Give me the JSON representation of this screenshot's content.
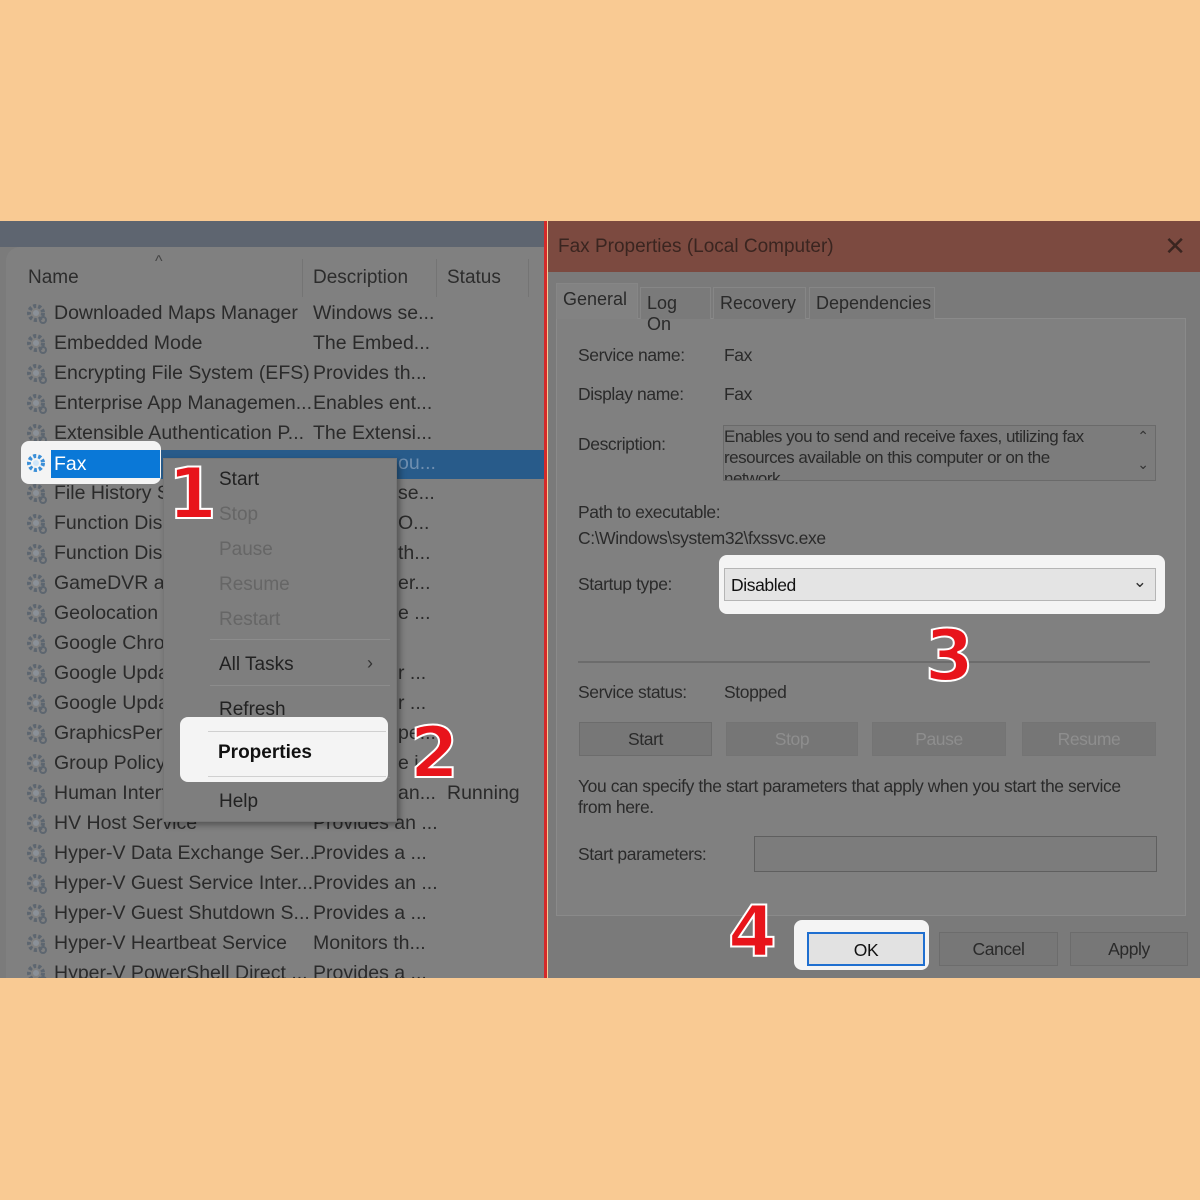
{
  "services_list": {
    "columns": {
      "name": "Name",
      "description": "Description",
      "status": "Status"
    },
    "rows": [
      {
        "name": "Downloaded Maps Manager",
        "description": "Windows se...",
        "status": ""
      },
      {
        "name": "Embedded Mode",
        "description": "The Embed...",
        "status": ""
      },
      {
        "name": "Encrypting File System (EFS)",
        "description": "Provides th...",
        "status": ""
      },
      {
        "name": "Enterprise App Managemen...",
        "description": "Enables ent...",
        "status": ""
      },
      {
        "name": "Extensible Authentication P...",
        "description": "The Extensi...",
        "status": ""
      },
      {
        "name": "Fax",
        "description": "ou...",
        "status": "",
        "selected": true
      },
      {
        "name": "File History S",
        "description": "se...",
        "status": ""
      },
      {
        "name": "Function Disc",
        "description": "O...",
        "status": ""
      },
      {
        "name": "Function Disc",
        "description": "th...",
        "status": ""
      },
      {
        "name": "GameDVR an",
        "description": "er...",
        "status": ""
      },
      {
        "name": "Geolocation S",
        "description": "e ...",
        "status": ""
      },
      {
        "name": "Google Chro",
        "description": "",
        "status": ""
      },
      {
        "name": "Google Upda",
        "description": "r ...",
        "status": ""
      },
      {
        "name": "Google Upda",
        "description": "r ...",
        "status": ""
      },
      {
        "name": "GraphicsPerfS",
        "description": "pe...",
        "status": ""
      },
      {
        "name": "Group Policy",
        "description": "e i...",
        "status": ""
      },
      {
        "name": "Human Interf",
        "description": "an...",
        "status": "Running"
      },
      {
        "name": "HV Host Service",
        "description": "Provides an ...",
        "status": ""
      },
      {
        "name": "Hyper-V Data Exchange Ser...",
        "description": "Provides a ...",
        "status": ""
      },
      {
        "name": "Hyper-V Guest Service Inter...",
        "description": "Provides an ...",
        "status": ""
      },
      {
        "name": "Hyper-V Guest Shutdown S...",
        "description": "Provides a ...",
        "status": ""
      },
      {
        "name": "Hyper-V Heartbeat Service",
        "description": "Monitors th...",
        "status": ""
      },
      {
        "name": "Hyper-V PowerShell Direct ...",
        "description": "Provides a ...",
        "status": ""
      }
    ]
  },
  "context_menu": {
    "items": [
      {
        "label": "Start",
        "enabled": true
      },
      {
        "label": "Stop",
        "enabled": false
      },
      {
        "label": "Pause",
        "enabled": false
      },
      {
        "label": "Resume",
        "enabled": false
      },
      {
        "label": "Restart",
        "enabled": false
      },
      {
        "label": "All Tasks",
        "enabled": true,
        "submenu": true
      },
      {
        "label": "Refresh",
        "enabled": true
      },
      {
        "label": "Properties",
        "enabled": true,
        "highlighted": true
      },
      {
        "label": "Help",
        "enabled": true
      }
    ]
  },
  "dialog": {
    "title": "Fax Properties (Local Computer)",
    "tabs": [
      "General",
      "Log On",
      "Recovery",
      "Dependencies"
    ],
    "active_tab": "General",
    "service_name_label": "Service name:",
    "service_name": "Fax",
    "display_name_label": "Display name:",
    "display_name": "Fax",
    "description_label": "Description:",
    "description": "Enables you to send and receive faxes, utilizing fax resources available on this computer or on the network",
    "path_label": "Path to executable:",
    "path": "C:\\Windows\\system32\\fxssvc.exe",
    "startup_type_label": "Startup type:",
    "startup_type": "Disabled",
    "service_status_label": "Service status:",
    "service_status": "Stopped",
    "control_buttons": [
      {
        "label": "Start",
        "enabled": true
      },
      {
        "label": "Stop",
        "enabled": false
      },
      {
        "label": "Pause",
        "enabled": false
      },
      {
        "label": "Resume",
        "enabled": false
      }
    ],
    "hint": "You can specify the start parameters that apply when you start the service from here.",
    "start_parameters_label": "Start parameters:",
    "start_parameters": "",
    "ok": "OK",
    "cancel": "Cancel",
    "apply": "Apply"
  },
  "step_numbers": [
    "1",
    "2",
    "3",
    "4"
  ],
  "colors": {
    "background": "#f9ca93",
    "step_number": "#e8141b",
    "selection": "#0a78d7",
    "title_bar": "#7c4a40"
  }
}
